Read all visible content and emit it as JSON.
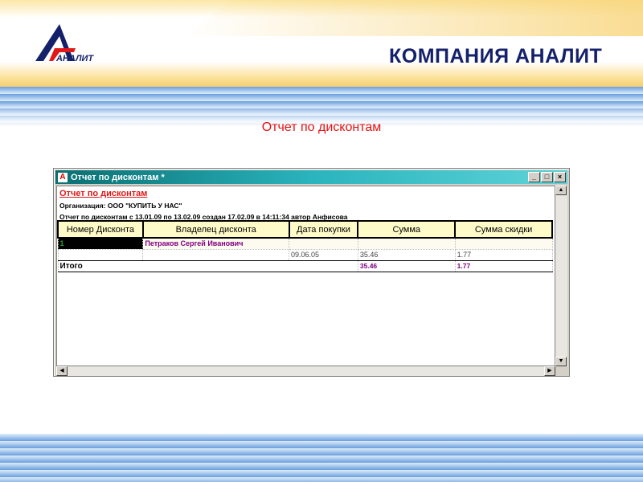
{
  "header": {
    "company": "КОМПАНИЯ АНАЛИТ",
    "logo_text": "АНАЛИТ"
  },
  "slide_title": "Отчет по дисконтам",
  "window": {
    "title": "Отчет по дисконтам  *",
    "buttons": {
      "minimize": "_",
      "maximize": "□",
      "close": "×"
    }
  },
  "report": {
    "title": "Отчет по дисконтам",
    "organization": "Организация: ООО \"КУПИТЬ У НАС\"",
    "period": "Отчет по дисконтам  с 13.01.09 по 13.02.09 создан 17.02.09 в 14:11:34 автор Анфисова",
    "columns": [
      "Номер Дисконта",
      "Владелец дисконта",
      "Дата покупки",
      "Сумма",
      "Сумма скидки"
    ],
    "group": {
      "number": "1",
      "owner": "Петраков  Сергей  Иванович"
    },
    "rows": [
      {
        "date": "09.06.05",
        "sum": "35.46",
        "discount": "1.77"
      }
    ],
    "total": {
      "label": "Итого",
      "sum": "35.46",
      "discount": "1.77"
    }
  },
  "colors": {
    "accent": "#e81010",
    "brand": "#14216a",
    "header_bg": "#fffbc8"
  }
}
